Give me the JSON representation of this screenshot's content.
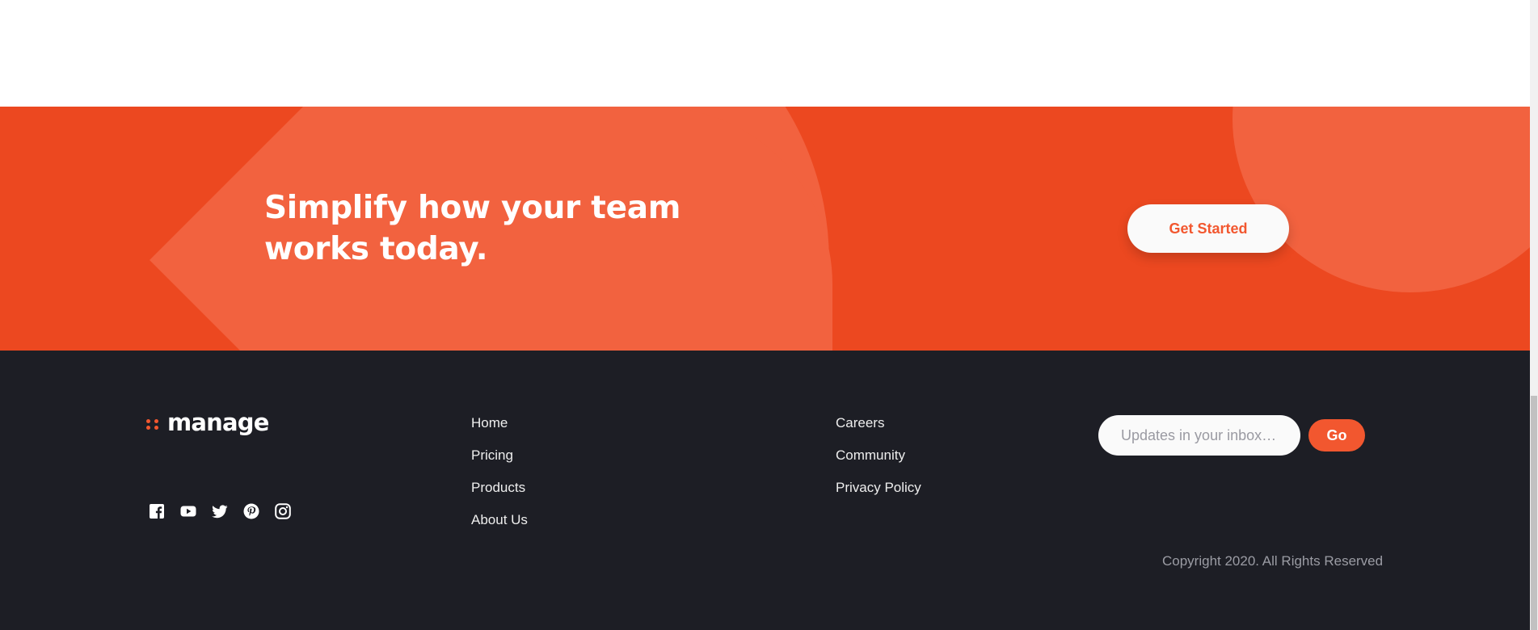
{
  "cta": {
    "heading": "Simplify how your team works today.",
    "button_label": "Get Started"
  },
  "footer": {
    "logo_text": "manage",
    "social_icons": [
      "facebook-icon",
      "youtube-icon",
      "twitter-icon",
      "pinterest-icon",
      "instagram-icon"
    ],
    "nav_col_1": [
      "Home",
      "Pricing",
      "Products",
      "About Us"
    ],
    "nav_col_2": [
      "Careers",
      "Community",
      "Privacy Policy"
    ],
    "newsletter": {
      "placeholder": "Updates in your inbox…",
      "button_label": "Go"
    },
    "copyright": "Copyright 2020. All Rights Reserved"
  },
  "colors": {
    "bright_red": "#f2572f",
    "cta_background": "#ec4820",
    "footer_background": "#1d1e25"
  }
}
